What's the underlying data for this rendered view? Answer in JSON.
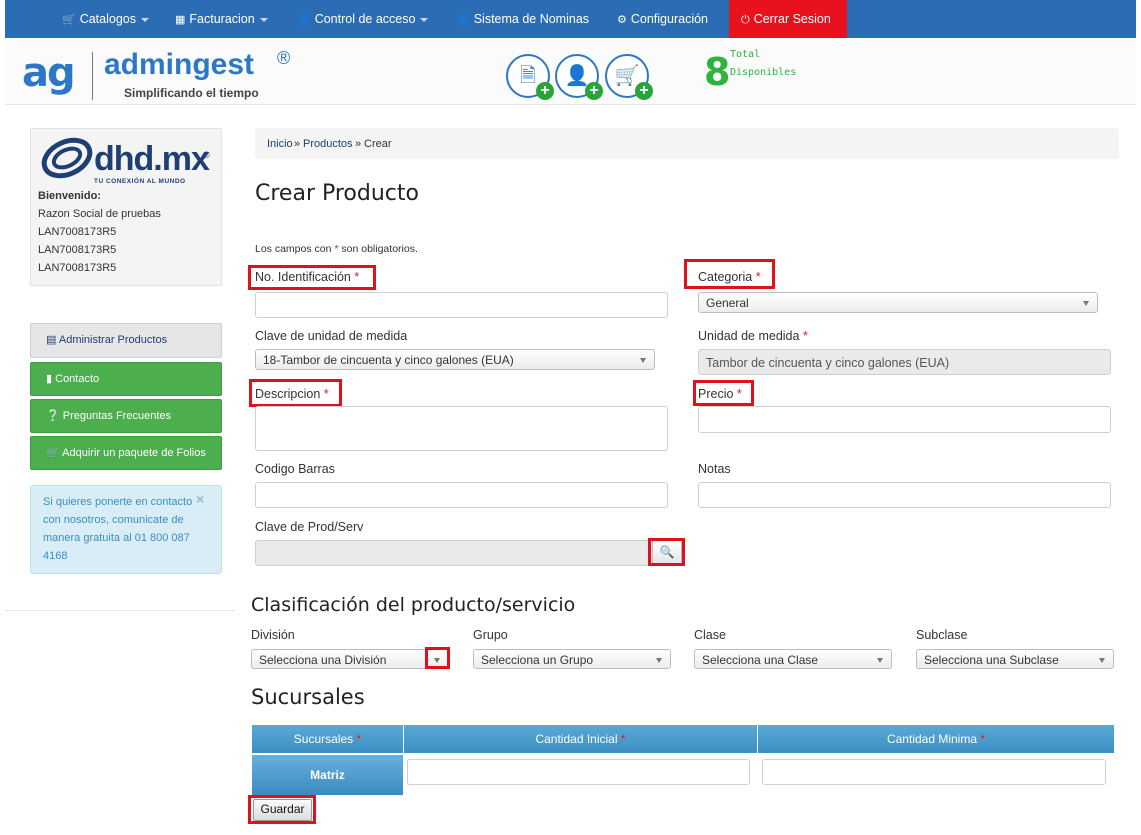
{
  "nav": {
    "items": [
      {
        "icon": "cart-icon",
        "label": "Catalogos",
        "caret": true
      },
      {
        "icon": "grid-icon",
        "label": "Facturacion",
        "caret": true
      },
      {
        "icon": "user-icon",
        "label": "Control de acceso",
        "caret": true
      },
      {
        "icon": "user-icon",
        "label": "Sistema de Nominas",
        "caret": false
      },
      {
        "icon": "gear-icon",
        "label": "Configuración",
        "caret": false
      }
    ],
    "logout": {
      "icon": "power-icon",
      "label": "Cerrar Sesion"
    },
    "color": "#2a6db5",
    "logout_color": "#e8111d"
  },
  "brand": {
    "mark": "ag",
    "name": "admingest",
    "registered": "®",
    "tagline": "Simplificando el tiempo"
  },
  "quick_actions": [
    {
      "icon": "invoice-add-icon"
    },
    {
      "icon": "user-add-icon"
    },
    {
      "icon": "cart-add-icon"
    }
  ],
  "folios": {
    "count": "8",
    "line1": "Total",
    "line2": "Disponibles",
    "color": "#2fb33f"
  },
  "sidebar": {
    "company_logo_text": "dhd.mx",
    "company_logo_reg": "®",
    "company_tagline": "TU CONEXIÓN AL MUNDO",
    "welcome": "Bienvenido:",
    "lines": [
      "Razon Social de pruebas",
      "LAN7008173R5",
      "LAN7008173R5",
      "LAN7008173R5"
    ],
    "buttons": [
      {
        "icon": "list-icon",
        "label": "Administrar Productos"
      },
      {
        "icon": "chat-icon",
        "label": "Contacto"
      },
      {
        "icon": "question-icon",
        "label": "Preguntas Frecuentes"
      },
      {
        "icon": "cart-icon",
        "label": "Adquirir un paquete de Folios"
      }
    ],
    "info": "Si quieres ponerte en contacto con nosotros, comunicate de manera gratuita al 01 800 087 4168",
    "info_close": "×"
  },
  "breadcrumb": {
    "items": [
      "Inicio",
      "Productos",
      "Crear"
    ],
    "sep": "»"
  },
  "page": {
    "title": "Crear Producto",
    "required_note_pre": "Los campos con ",
    "required_star": "*",
    "required_note_post": " son obligatorios."
  },
  "form": {
    "identificacion": {
      "label": "No. Identificación",
      "value": ""
    },
    "categoria": {
      "label": "Categoria",
      "value": "General"
    },
    "clave_unidad": {
      "label": "Clave de unidad de medida",
      "value": "18-Tambor de cincuenta y cinco galones (EUA)"
    },
    "unidad": {
      "label": "Unidad de medida",
      "value": "Tambor de cincuenta y cinco galones (EUA)"
    },
    "descripcion": {
      "label": "Descripcion",
      "value": ""
    },
    "precio": {
      "label": "Precio",
      "value": ""
    },
    "codigo_barras": {
      "label": "Codigo Barras",
      "value": ""
    },
    "notas": {
      "label": "Notas",
      "value": ""
    },
    "clave_prod": {
      "label": "Clave de Prod/Serv",
      "value": ""
    },
    "star": "*"
  },
  "clasificacion": {
    "title": "Clasificación del producto/servicio",
    "division": {
      "label": "División",
      "value": "Selecciona una División"
    },
    "grupo": {
      "label": "Grupo",
      "value": "Selecciona un Grupo"
    },
    "clase": {
      "label": "Clase",
      "value": "Selecciona una Clase"
    },
    "subclase": {
      "label": "Subclase",
      "value": "Selecciona una Subclase"
    }
  },
  "sucursales": {
    "title": "Sucursales",
    "headers": [
      "Sucursales",
      "Cantidad Inicial",
      "Cantidad Minima"
    ],
    "star": "*",
    "rows": [
      {
        "name": "Matriz",
        "inicial": "",
        "minima": ""
      }
    ]
  },
  "save_label": "Guardar",
  "highlight_color": "#e0101c"
}
